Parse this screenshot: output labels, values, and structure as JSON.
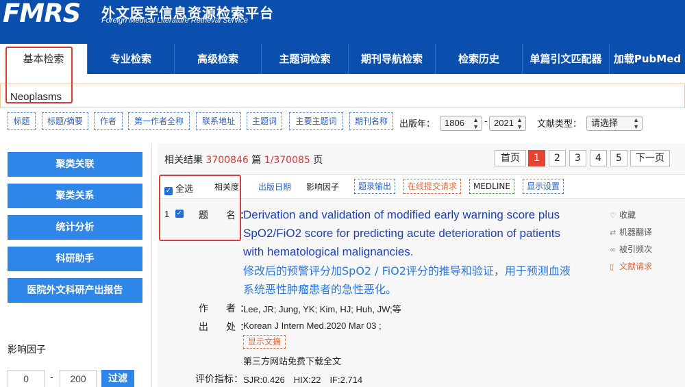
{
  "brand": {
    "logo": "FMRS",
    "name_cn": "外文医学信息资源检索平台",
    "name_en": "Foreign Medical Literature Retrieval Service",
    "bg_color": "#0a4fae"
  },
  "nav": {
    "tabs": [
      "基本检索",
      "专业检索",
      "高级检索",
      "主题词检索",
      "期刊导航检索",
      "检索历史",
      "单篇引文匹配器",
      "加载PubMed"
    ],
    "active": "基本检索"
  },
  "search": {
    "value": "Neoplasms"
  },
  "fields": [
    "标题",
    "标题/摘要",
    "作者",
    "第一作者全称",
    "联系地址",
    "主题词",
    "主要主题词",
    "期刊名称"
  ],
  "filters": {
    "year_label": "出版年：",
    "year_from": "1806",
    "year_sep": "-",
    "year_to": "2021",
    "doctype_label": "文献类型：",
    "doctype_value": "请选择"
  },
  "sidebar": {
    "buttons": [
      "聚类关联",
      "聚类关系",
      "统计分析",
      "科研助手",
      "医院外文科研产出报告"
    ],
    "impact_label": "影响因子",
    "impact_min": "0",
    "impact_sep": "-",
    "impact_max": "200",
    "filter_button": "过滤",
    "accent_color": "#2d86e8"
  },
  "results": {
    "prefix": "相关结果",
    "count": "3700846",
    "unit": "篇",
    "page_info": "1/370085",
    "page_unit": "页",
    "pagination": {
      "first": "首页",
      "pages": [
        "1",
        "2",
        "3",
        "4",
        "5"
      ],
      "current": "1",
      "next": "下一页"
    },
    "toolbar": {
      "select_all": "全选",
      "sort_relevance": "相关度",
      "sort_date": "出版日期",
      "sort_impact": "影响因子",
      "export": "题录输出",
      "submit_request": "在线提交请求",
      "medline": "MEDLINE",
      "display_settings": "显示设置"
    },
    "record": {
      "number": "1",
      "title_label": "题　名：",
      "title_en": "Derivation and validation of modified early warning score plus SpO2/FiO2 score for predicting acute deterioration of patients with hematological malignancies.",
      "title_cn": "修改后的预警评分加SpO2 / FiO2评分的推导和验证，用于预测血液系统恶性肿瘤患者的急性恶化。",
      "author_label": "作　者：",
      "authors": "Lee, JR; Jung, YK; Kim, HJ; Huh, JW;等",
      "source_label": "出　处：",
      "source": "Korean J Intern Med.2020 Mar 03 ;",
      "show_abstract": "显示文摘",
      "free_text": "第三方网站免费下载全文",
      "metrics_label": "评价指标：",
      "metrics": "SJR:0.426　HIX:22　IF:2.714"
    },
    "actions": [
      "收藏",
      "机器翻译",
      "被引频次",
      "文献请求"
    ]
  }
}
